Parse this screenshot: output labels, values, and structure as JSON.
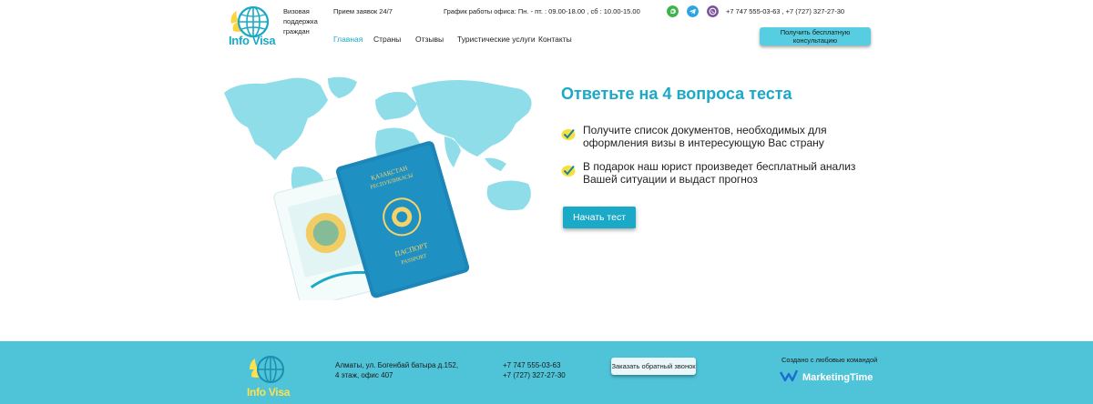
{
  "header": {
    "logo_text": "Info Visa",
    "tagline": "Визовая поддержка граждан",
    "hours_label": "Прием заявок 24/7",
    "schedule": "График работы офиса: Пн. - пт. : 09.00-18.00 , сб : 10.00-15.00",
    "phones": "+7 747 555-03-63 , +7 (727) 327-27-30",
    "consult_button": "Получить бесплатную консультацию",
    "nav": [
      "Главная",
      "Страны",
      "Отзывы",
      "Туристические услуги",
      "Контакты"
    ],
    "messengers": [
      "whatsapp-icon",
      "telegram-icon",
      "viber-icon"
    ],
    "accent_color": "#1aa9c7"
  },
  "hero": {
    "title": "Ответьте на 4 вопроса теста",
    "bullets": [
      "Получите список документов, необходимых для оформления визы в интересующую Вас страну",
      "В подарок наш юрист произведет бесплатный анализ Вашей ситуации и выдаст прогноз"
    ],
    "start_button": "Начать тест"
  },
  "footer": {
    "background_color": "#4fc3d7",
    "logo_text": "Info Visa",
    "address_line1": "Алматы, ул. Богенбай батыра д.152,",
    "address_line2": "4 этаж, офис 407",
    "phone1": "+7 747 555-03-63",
    "phone2": "+7 (727) 327-27-30",
    "callback_button": "Заказать обратный звонок",
    "made_by": "Создано с любовью командой",
    "made_by_brand": "MarketingTime"
  }
}
